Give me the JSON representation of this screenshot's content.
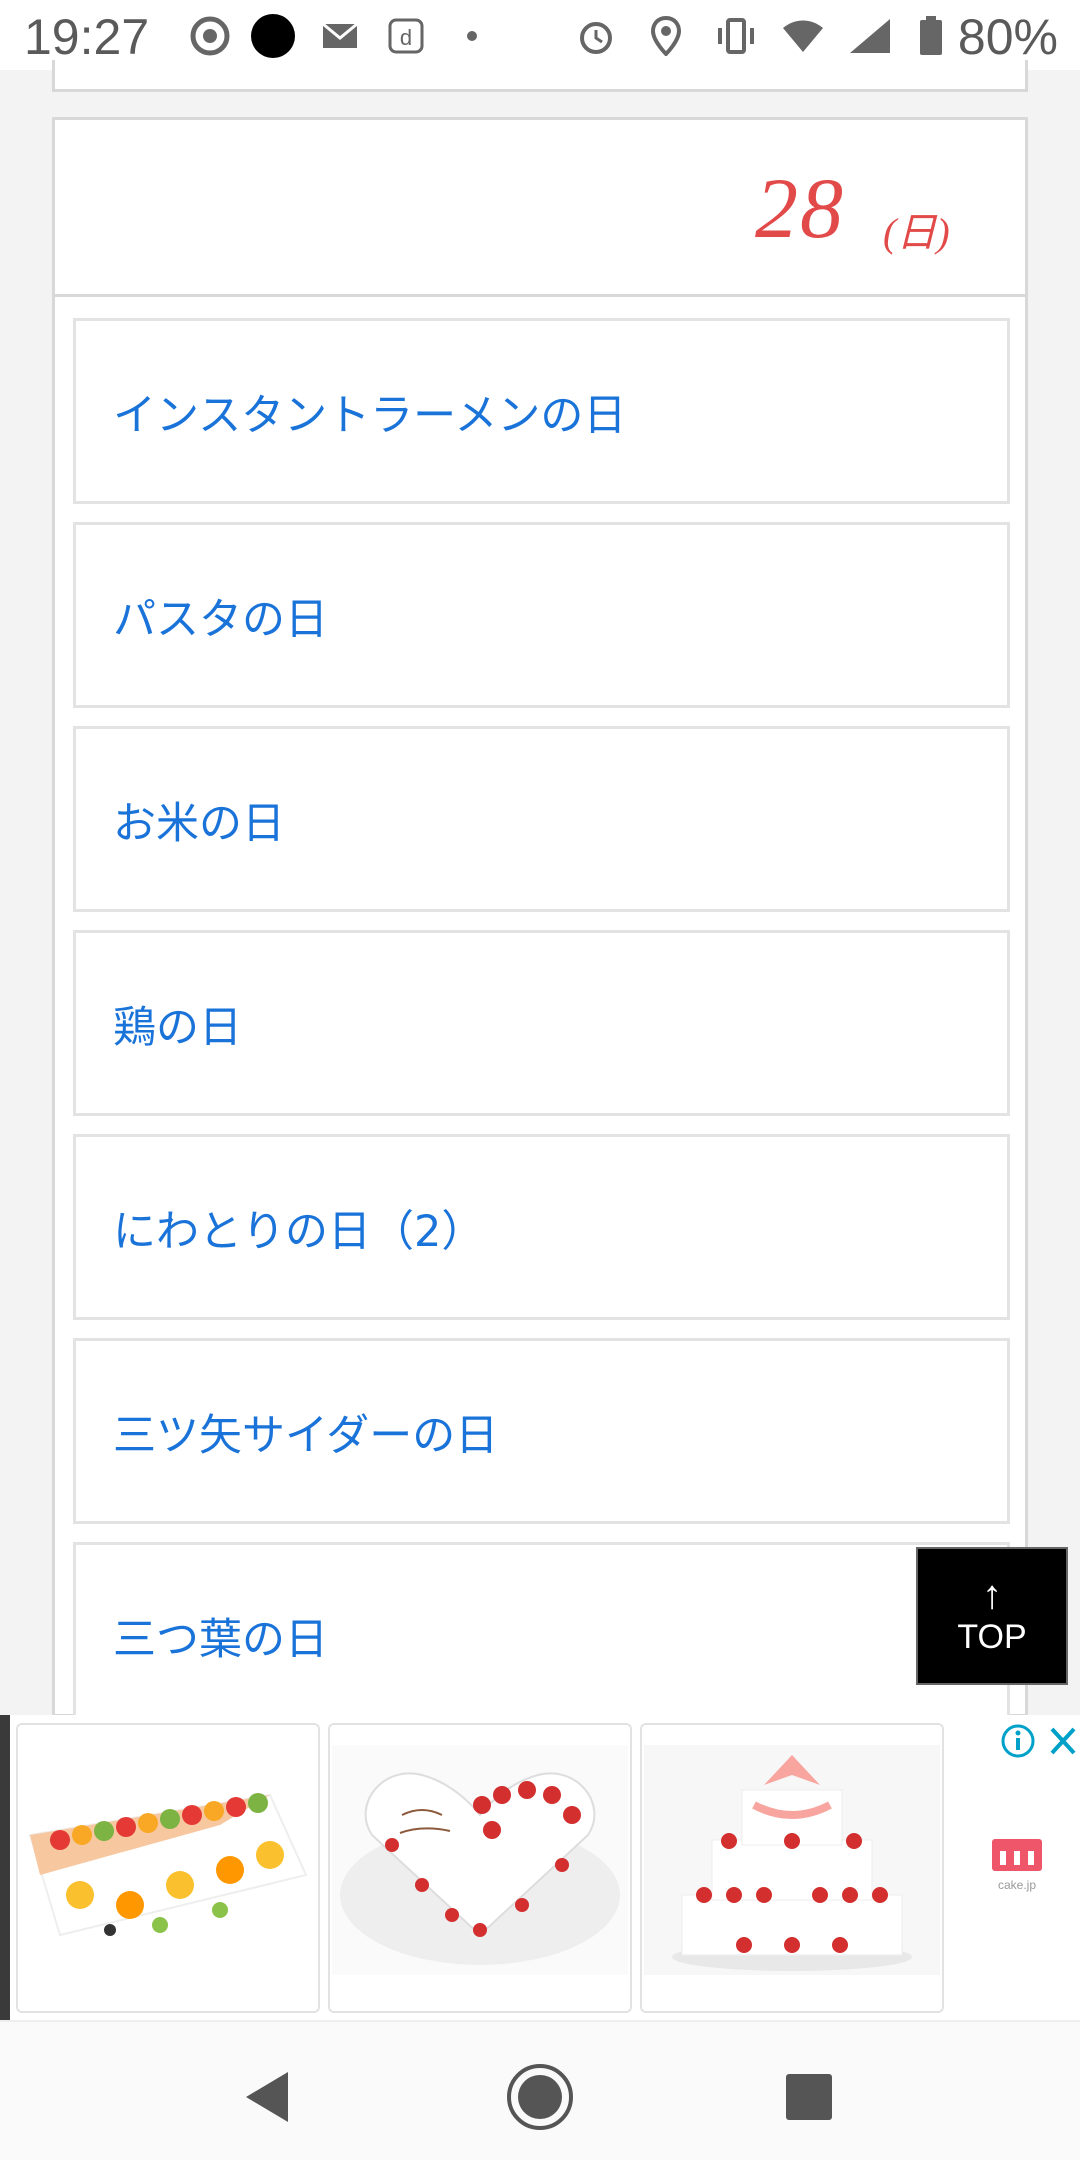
{
  "status_bar": {
    "time": "19:27",
    "battery": "80%",
    "icons": [
      "chrome-icon",
      "dot-icon",
      "mail-icon",
      "docomo-icon",
      "small-dot-icon",
      "alarm-icon",
      "location-icon",
      "vibrate-icon",
      "wifi-icon",
      "signal-icon",
      "battery-icon"
    ]
  },
  "day": {
    "number": "28",
    "weekday": "(日)",
    "accent_color": "#e24a4a"
  },
  "events": [
    {
      "label": "インスタントラーメンの日"
    },
    {
      "label": "パスタの日"
    },
    {
      "label": "お米の日"
    },
    {
      "label": "鶏の日"
    },
    {
      "label": "にわとりの日（2）"
    },
    {
      "label": "三ツ矢サイダーの日"
    },
    {
      "label": "三つ葉の日"
    }
  ],
  "link_color": "#1a73d9",
  "top_button": {
    "arrow": "↑",
    "label": "TOP"
  },
  "ad": {
    "tiles": [
      "fruit-sheet-cake-image",
      "heart-wedding-cake-image",
      "tiered-strawberry-cake-image"
    ],
    "brand": "cake.jp"
  },
  "nav": [
    "back-icon",
    "home-icon",
    "recents-icon"
  ]
}
